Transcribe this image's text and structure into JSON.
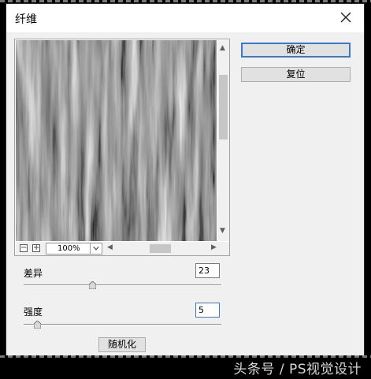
{
  "dialog": {
    "title": "纤维"
  },
  "buttons": {
    "ok": "确定",
    "reset": "复位",
    "randomize": "随机化"
  },
  "zoom": {
    "value": "100%"
  },
  "params": {
    "variance": {
      "label": "差异",
      "value": "23",
      "fraction": 0.35
    },
    "strength": {
      "label": "强度",
      "value": "5",
      "fraction": 0.07
    }
  },
  "watermark": "头条号 / PS视觉设计",
  "icons": [
    "close-icon",
    "zoom-out-icon",
    "zoom-in-icon",
    "chevron-down-icon",
    "scroll-up-arrow-icon",
    "scroll-down-arrow-icon",
    "scroll-left-arrow-icon",
    "scroll-right-arrow-icon"
  ]
}
